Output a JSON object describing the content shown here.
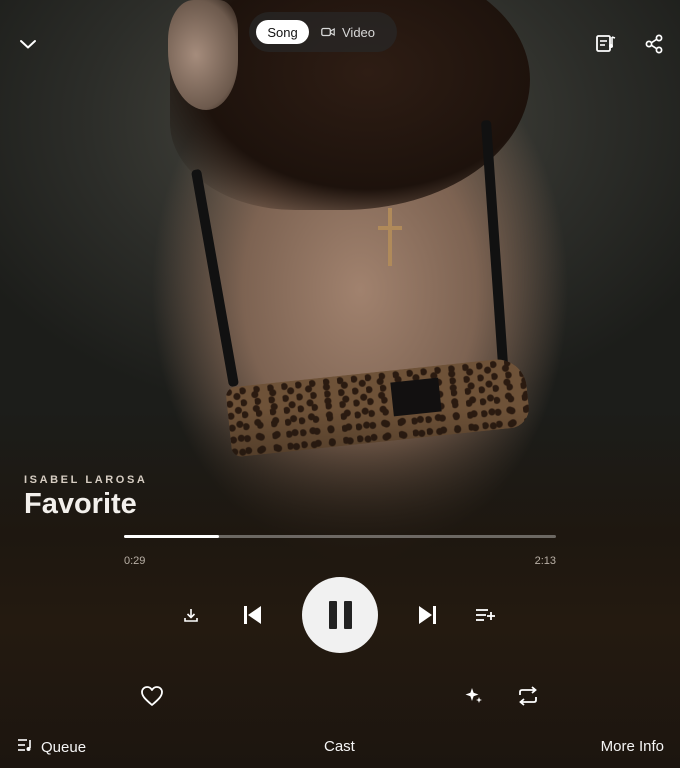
{
  "header": {
    "collapse_icon": "chevron-down-icon",
    "mode_toggle": {
      "song_label": "Song",
      "video_label": "Video",
      "selected": "Song"
    },
    "lyrics_icon": "lyrics-icon",
    "share_icon": "share-icon"
  },
  "track": {
    "artist": "ISABEL LAROSA",
    "title": "Favorite"
  },
  "playback": {
    "current_time": "0:29",
    "total_time": "2:13",
    "progress_fraction": 0.22,
    "state": "playing"
  },
  "controls": {
    "download_icon": "download-icon",
    "previous_icon": "skip-previous-icon",
    "pause_icon": "pause-icon",
    "next_icon": "skip-next-icon",
    "add_to_queue_icon": "playlist-add-icon",
    "like_icon": "heart-icon",
    "sparkle_icon": "sparkle-icon",
    "repeat_icon": "repeat-icon"
  },
  "bottom_nav": {
    "queue_label": "Queue",
    "cast_label": "Cast",
    "more_info_label": "More Info"
  }
}
